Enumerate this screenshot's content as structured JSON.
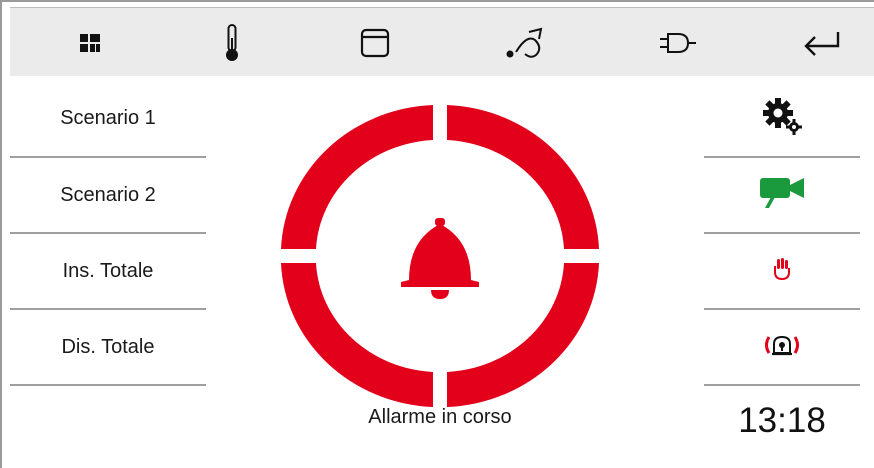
{
  "colors": {
    "alarm_red": "#e2001a",
    "camera_green": "#1a9a3c",
    "topbar_bg": "#ebebeb",
    "separator": "#9f9f9f"
  },
  "topbar": {
    "icons": [
      "grid-icon",
      "thermometer-icon",
      "shutter-icon",
      "watering-can-icon",
      "plug-icon",
      "back-arrow-icon"
    ]
  },
  "scenarios": {
    "items": [
      {
        "label": "Scenario 1"
      },
      {
        "label": "Scenario 2"
      },
      {
        "label": "Ins. Totale"
      },
      {
        "label": "Dis. Totale"
      }
    ]
  },
  "alarm": {
    "status": "Allarme in corso",
    "icon": "bell-icon"
  },
  "right_panel": {
    "icons": [
      "settings-icon",
      "camera-icon",
      "hand-icon",
      "siren-icon"
    ],
    "time": "13:18"
  }
}
